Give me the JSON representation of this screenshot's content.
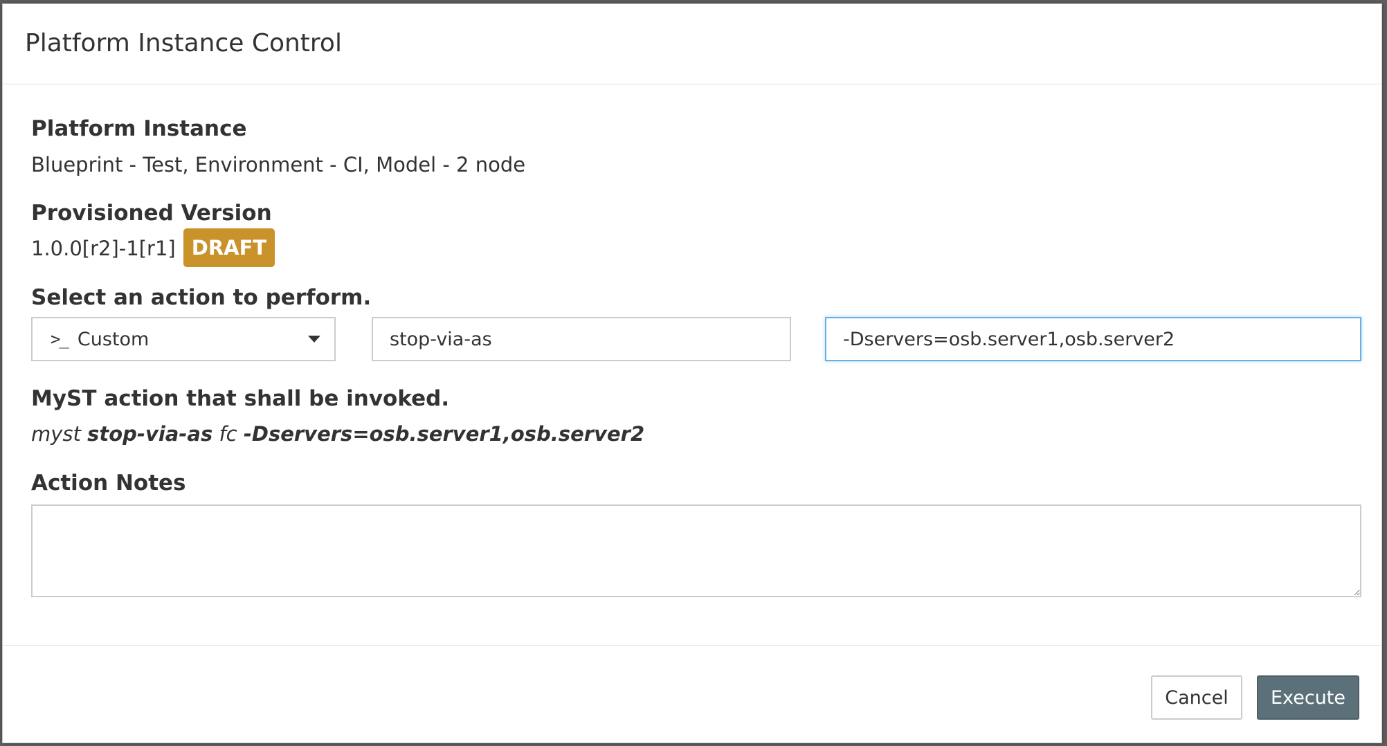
{
  "dialog": {
    "title": "Platform Instance Control"
  },
  "platform_instance": {
    "label": "Platform Instance",
    "value": "Blueprint - Test, Environment - CI, Model - 2 node"
  },
  "provisioned_version": {
    "label": "Provisioned Version",
    "value": "1.0.0[r2]-1[r1]",
    "badge": "DRAFT",
    "badge_color": "#c9922a"
  },
  "action": {
    "label": "Select an action to perform.",
    "select_icon": "terminal-icon",
    "select_value": "Custom",
    "action_name_value": "stop-via-as",
    "params_value": "-Dservers=osb.server1,osb.server2"
  },
  "invocation": {
    "label": "MyST action that shall be invoked.",
    "cmd": "myst",
    "action": "stop-via-as",
    "target": "fc",
    "params": "-Dservers=osb.server1,osb.server2"
  },
  "notes": {
    "label": "Action Notes",
    "value": ""
  },
  "footer": {
    "cancel_label": "Cancel",
    "execute_label": "Execute",
    "execute_color": "#5b7078"
  }
}
